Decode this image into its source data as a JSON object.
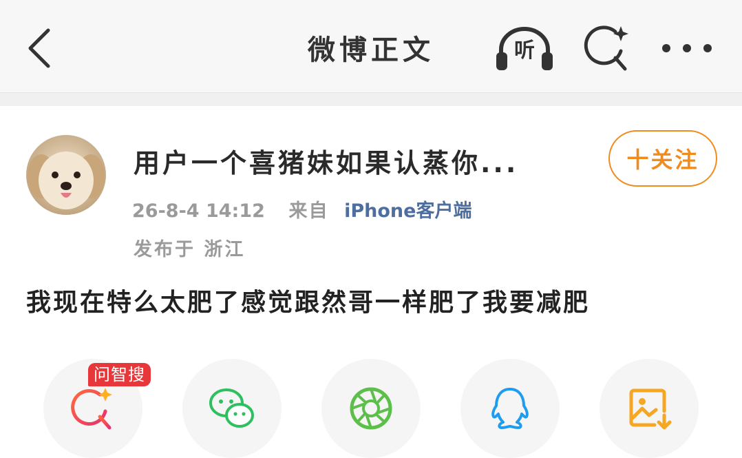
{
  "header": {
    "title": "微博正文",
    "listen_label": "听",
    "icons": [
      "back-chevron-icon",
      "headphones-icon",
      "ai-search-icon",
      "more-dots-icon"
    ]
  },
  "post": {
    "username": "用户一个喜猪妹如果认蒸你...",
    "follow_label": "十关注",
    "time": "26-8-4 14:12",
    "source_prefix": "来自",
    "source_client": "iPhone客户端",
    "location": "发布于 浙江",
    "text": "我现在特么太肥了感觉跟然哥一样肥了我要减肥"
  },
  "share": {
    "ai_badge": "问智搜",
    "items": [
      "ai-search-share-icon",
      "wechat-icon",
      "moments-icon",
      "qq-icon",
      "save-image-icon"
    ]
  },
  "colors": {
    "accent_orange": "#f08b1e",
    "link_blue": "#4f6ea0",
    "badge_red": "#e8373a",
    "wechat_green": "#2ebf5f",
    "moments_green": "#5cbf4a",
    "qq_blue": "#1e9cf0",
    "save_orange": "#f5a623"
  }
}
